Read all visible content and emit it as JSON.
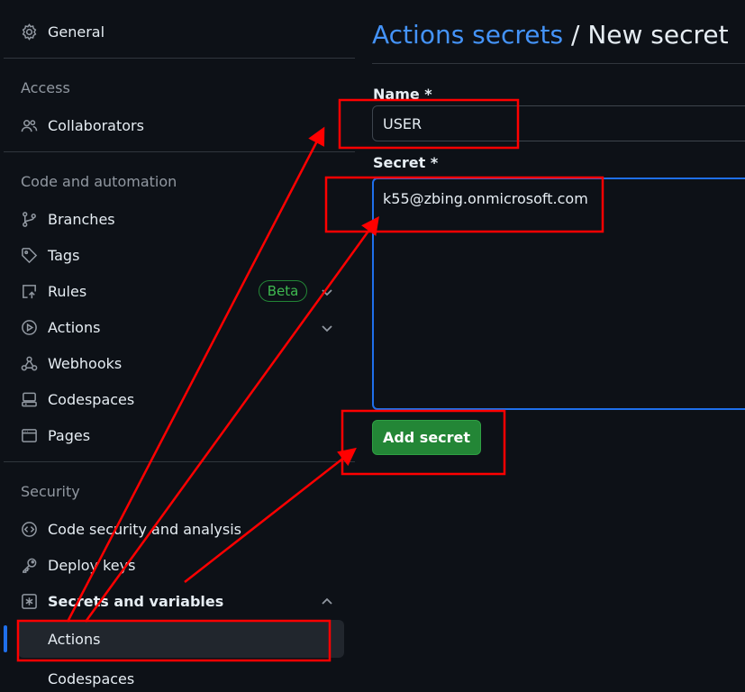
{
  "sidebar": {
    "general": "General",
    "access_heading": "Access",
    "collaborators": "Collaborators",
    "code_heading": "Code and automation",
    "branches": "Branches",
    "tags": "Tags",
    "rules": "Rules",
    "rules_badge": "Beta",
    "actions": "Actions",
    "webhooks": "Webhooks",
    "codespaces": "Codespaces",
    "pages": "Pages",
    "security_heading": "Security",
    "code_security": "Code security and analysis",
    "deploy_keys": "Deploy keys",
    "secrets_variables": "Secrets and variables",
    "sub_actions": "Actions",
    "sub_codespaces": "Codespaces"
  },
  "main": {
    "breadcrumb": "Actions secrets",
    "separator": " / ",
    "title": "New secret",
    "name_label": "Name *",
    "name_value": "USER",
    "secret_label": "Secret *",
    "secret_value": "k55@zbing.onmicrosoft.com",
    "add_button": "Add secret"
  },
  "icons": [
    "gear-icon",
    "people-icon",
    "branch-icon",
    "tag-icon",
    "rules-icon",
    "play-icon",
    "webhook-icon",
    "codespaces-icon",
    "browser-icon",
    "codescan-icon",
    "key-icon",
    "asterisk-icon",
    "chevron-down-icon",
    "chevron-up-icon"
  ],
  "colors": {
    "background": "#0d1117",
    "link": "#4493f8",
    "button": "#238636",
    "annotation": "#ff0000",
    "active_indicator": "#1f6feb"
  }
}
